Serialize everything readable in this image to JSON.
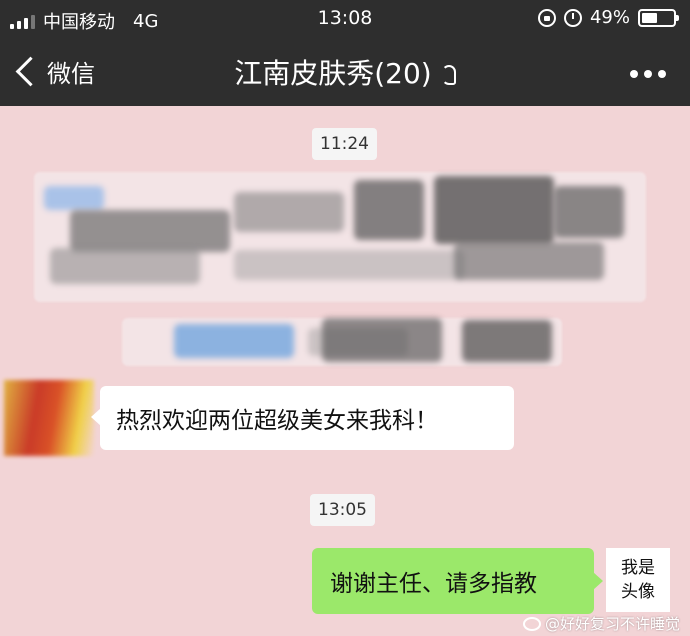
{
  "status_bar": {
    "carrier": "中国移动",
    "network": "4G",
    "time": "13:08",
    "battery": "49%",
    "battery_level": 0.49
  },
  "nav": {
    "back_label": "微信",
    "chat_title": "江南皮肤秀(20)"
  },
  "messages": {
    "time_1": "11:24",
    "incoming_text": "热烈欢迎两位超级美女来我科！",
    "time_2": "13:05",
    "outgoing_text": "谢谢主任、请多指教",
    "my_avatar_text": "我是\n头像"
  },
  "watermark": {
    "text": "@好好复习不许睡觉"
  },
  "colors": {
    "bar": "#2e2e2e",
    "background": "#f2d4d6",
    "outgoing_bubble": "#9be86a"
  }
}
